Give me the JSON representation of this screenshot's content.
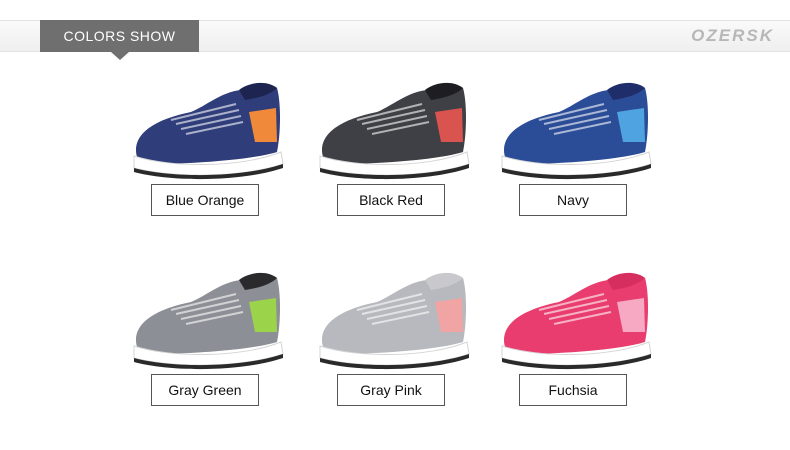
{
  "header": {
    "tab_label": "COLORS SHOW",
    "brand": "OZERSK"
  },
  "products": [
    {
      "label": "Blue Orange",
      "upper": "#2f3d7a",
      "accent": "#f08a3a",
      "collar": "#1d2450"
    },
    {
      "label": "Black Red",
      "upper": "#3f3f46",
      "accent": "#d9534f",
      "collar": "#1e1e22"
    },
    {
      "label": "Navy",
      "upper": "#2b4c97",
      "accent": "#4fa3e0",
      "collar": "#1f2e6a"
    },
    {
      "label": "Gray Green",
      "upper": "#8c8f95",
      "accent": "#9bd44a",
      "collar": "#2a2a2d"
    },
    {
      "label": "Gray Pink",
      "upper": "#b7b9bf",
      "accent": "#f1a4a4",
      "collar": "#c9c9cd"
    },
    {
      "label": "Fuchsia",
      "upper": "#e83d6e",
      "accent": "#f7a9c3",
      "collar": "#d62e5e"
    }
  ]
}
